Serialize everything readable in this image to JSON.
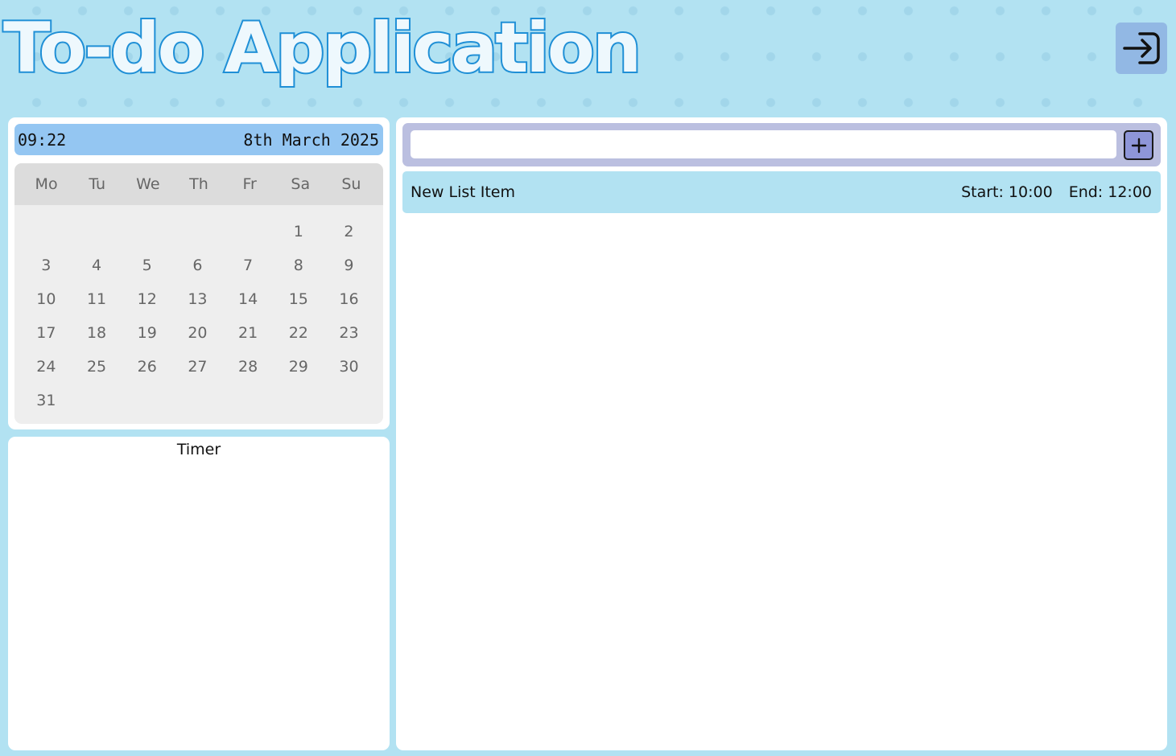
{
  "header": {
    "title": "To-do Application",
    "logout_icon": "logout-icon"
  },
  "clock": {
    "time": "09:22",
    "date": "8th March 2025"
  },
  "calendar": {
    "weekdays": [
      "Mo",
      "Tu",
      "We",
      "Th",
      "Fr",
      "Sa",
      "Su"
    ],
    "leading_blanks": 5,
    "days": [
      "1",
      "2",
      "3",
      "4",
      "5",
      "6",
      "7",
      "8",
      "9",
      "10",
      "11",
      "12",
      "13",
      "14",
      "15",
      "16",
      "17",
      "18",
      "19",
      "20",
      "21",
      "22",
      "23",
      "24",
      "25",
      "26",
      "27",
      "28",
      "29",
      "30",
      "31"
    ]
  },
  "timer": {
    "title": "Timer"
  },
  "todo": {
    "new_item_value": "",
    "add_icon": "plus-icon",
    "items": [
      {
        "name": "New List Item",
        "start": "Start: 10:00",
        "end": "End: 12:00"
      }
    ]
  },
  "colors": {
    "background": "#b2e2f2",
    "title_stroke": "#1f8fd6",
    "logout_button": "#92b8e4",
    "datetime_bar": "#94c6f2",
    "add_bar": "#bbbfe0",
    "add_button": "#8e96d8",
    "list_item": "#b2e2f2"
  }
}
